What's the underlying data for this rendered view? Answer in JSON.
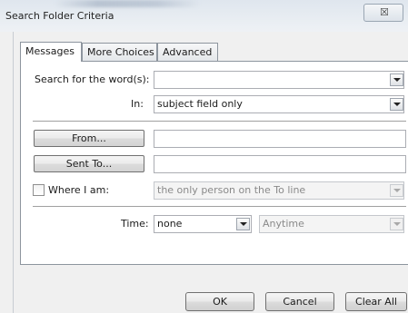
{
  "window": {
    "title": "Search Folder Criteria",
    "close_glyph": "☒"
  },
  "tabs": [
    {
      "label": "Messages",
      "active": true
    },
    {
      "label": "More Choices",
      "active": false
    },
    {
      "label": "Advanced",
      "active": false
    }
  ],
  "search": {
    "label": "Search for the word(s):",
    "value": ""
  },
  "in_field": {
    "label": "In:",
    "value": "subject field only"
  },
  "from": {
    "button_label": "From...",
    "value": ""
  },
  "sent_to": {
    "button_label": "Sent To...",
    "value": ""
  },
  "where": {
    "label": "Where I am:",
    "checked": false,
    "value": "the only person on the To line"
  },
  "time": {
    "label": "Time:",
    "value": "none",
    "range_value": "Anytime"
  },
  "buttons": {
    "ok": "OK",
    "cancel": "Cancel",
    "clear_all": "Clear All"
  }
}
